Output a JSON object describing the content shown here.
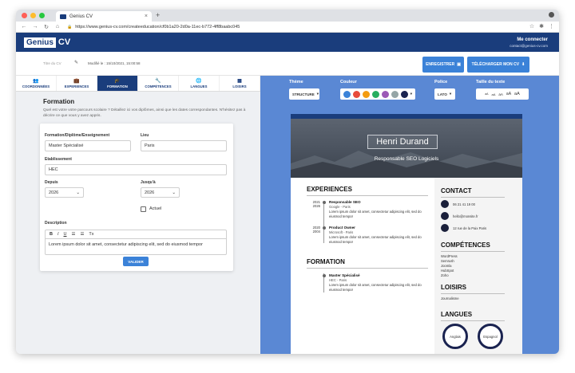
{
  "browser": {
    "tab_title": "Genius CV",
    "tab_close": "×",
    "new_tab": "+",
    "url": "https://www.genius-cv.com/createeducation/cf0b1a20-2d0a-11ec-b772-4ff8baabc045",
    "nav_back": "←",
    "nav_forward": "→",
    "nav_reload": "↻",
    "nav_home": "⌂",
    "dot_colors": [
      "#ff5f57",
      "#febc2e",
      "#28c840"
    ]
  },
  "header": {
    "logo_text": "Genius",
    "logo_suffix": "CV",
    "login_label": "Me connecter",
    "login_email": "contact@genius-cv.com"
  },
  "toolbar": {
    "cv_title": "Titre du CV",
    "modified": "Modifié le : 15/10/2021, 15:00:58",
    "save_label": "ENREGISTRER",
    "download_label": "TÉLÉCHARGER MON CV"
  },
  "nav_tabs": [
    {
      "label": "COORDONNÉES",
      "icon": "👥"
    },
    {
      "label": "EXPERIENCES",
      "icon": "💼"
    },
    {
      "label": "FORMATION",
      "icon": "🎓"
    },
    {
      "label": "COMPÉTENCES",
      "icon": "🔧"
    },
    {
      "label": "LANGUES",
      "icon": "🌐"
    },
    {
      "label": "LOISIRS",
      "icon": "▦"
    }
  ],
  "formation": {
    "title": "Formation",
    "description": "Quel est votre votre parcours scolaire ? Détaillez ici vos diplômes, ainsi que les dates correspondantes. N'hésitez pas à décrire ce que vous y avez appris.",
    "fields": {
      "diploma_label": "Formation/Diplôme/Enseignement",
      "diploma_value": "Master Spécialisé",
      "place_label": "Lieu",
      "place_value": "Paris",
      "school_label": "Etablissement",
      "school_value": "HEC",
      "from_label": "Depuis",
      "from_value": "2026",
      "to_label": "Jusqu'à",
      "to_value": "2026",
      "current_label": "Actuel",
      "desc_label": "Description",
      "desc_value": "Lorem ipsum dolor sit amet, consectetur adipiscing elit, sed do eiusmod tempor",
      "validate_label": "VALIDER"
    },
    "editor_tools": [
      "B",
      "I",
      "U",
      "☰",
      "☰",
      "Tx"
    ]
  },
  "design": {
    "theme_label": "Thème",
    "theme_value": "STRUCTURE",
    "color_label": "Couleur",
    "colors": [
      "#3b82d8",
      "#e74c3c",
      "#f39c12",
      "#27ae60",
      "#9b59b6",
      "#95a5a6",
      "#1a2350"
    ],
    "font_label": "Police",
    "font_value": "LATO",
    "size_label": "Taille du texte",
    "size_options": [
      "aA",
      "aA",
      "aA",
      "aA",
      "aA"
    ]
  },
  "cv_preview": {
    "name": "Henri Durand",
    "job": "Responsable SEO Logiciels",
    "experiences_heading": "EXPERIENCES",
    "experiences": [
      {
        "years": "2021\n2026",
        "title": "Responsable SEO",
        "sub": "Google - Paris",
        "desc": "Lorem ipsum dolor sit amet, consectetur adipiscing elit, sed do eiusmod tempor"
      },
      {
        "years": "2020\n2004",
        "title": "Product Owner",
        "sub": "Microsoft - Paris",
        "desc": "Lorem ipsum dolor sit amet, consectetur adipiscing elit, sed do eiusmod tempor"
      }
    ],
    "formation_heading": "FORMATION",
    "formations": [
      {
        "title": "Master Spécialisé",
        "sub": "HEC - Paris",
        "desc": "Lorem ipsum dolor sit amet, consectetur adipiscing elit, sed do eiusmod tempor"
      }
    ],
    "contact_heading": "CONTACT",
    "contacts": [
      "06 21 41 19 00",
      "hello@monsite.fr",
      "12 rue de la Paix Paris"
    ],
    "skills_heading": "COMPÉTENCES",
    "skills": [
      "WordPress",
      "Semrush",
      "Joomla",
      "HubSpot",
      "Zoho"
    ],
    "hobbies_heading": "LOISIRS",
    "hobbies": [
      "Journalisme"
    ],
    "languages_heading": "LANGUES",
    "languages": [
      "Anglais",
      "Espagnol"
    ]
  }
}
